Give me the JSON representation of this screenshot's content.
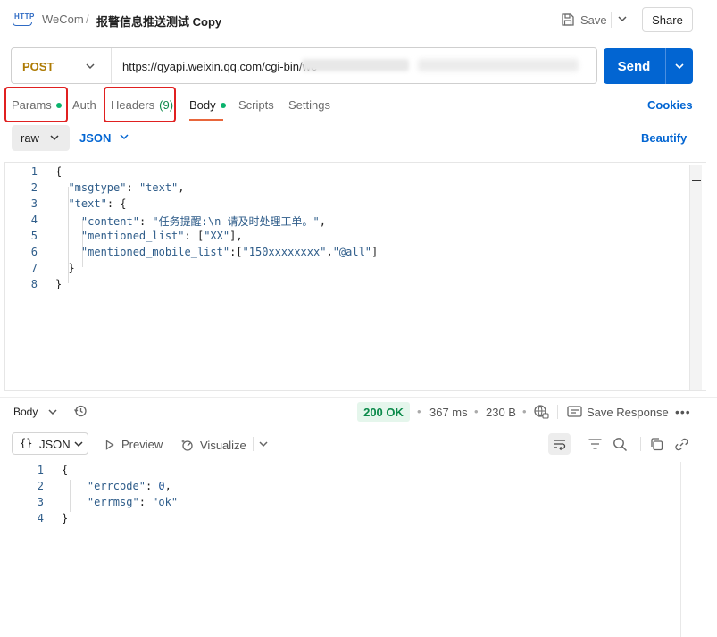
{
  "header": {
    "app_icon": "http-icon",
    "app_icon_text": "HTTP",
    "breadcrumb_parent": "WeCom",
    "breadcrumb_sep": "/",
    "title": "报警信息推送测试 Copy",
    "save_label": "Save",
    "share_label": "Share"
  },
  "request": {
    "method": "POST",
    "url": "https://qyapi.weixin.qq.com/cgi-bin/we",
    "send_label": "Send"
  },
  "tabs": {
    "params": "Params",
    "auth": "Auth",
    "headers": "Headers",
    "headers_count": "(9)",
    "body": "Body",
    "scripts": "Scripts",
    "settings": "Settings",
    "cookies": "Cookies"
  },
  "body_options": {
    "mode": "raw",
    "language": "JSON",
    "beautify": "Beautify"
  },
  "request_body": {
    "line_numbers": [
      "1",
      "2",
      "3",
      "4",
      "5",
      "6",
      "7",
      "8"
    ],
    "lines": [
      "{",
      "  \"msgtype\": \"text\",",
      "  \"text\": {",
      "    \"content\": \"任务提醒:\\n 请及时处理工单。\",",
      "    \"mentioned_list\": [\"XX\"],",
      "    \"mentioned_mobile_list\":[\"150xxxxxxxx\",\"@all\"]",
      "  }",
      "}"
    ]
  },
  "response": {
    "body_label": "Body",
    "status": "200 OK",
    "time": "367 ms",
    "size": "230 B",
    "save_response": "Save Response",
    "more": "•••",
    "format": "JSON",
    "format_brace": "{}",
    "preview": "Preview",
    "visualize": "Visualize",
    "line_numbers": [
      "1",
      "2",
      "3",
      "4"
    ],
    "lines": [
      "{",
      "    \"errcode\": 0,",
      "    \"errmsg\": \"ok\"",
      "}"
    ]
  },
  "colors": {
    "accent": "#0265d2",
    "method": "#ad7a03",
    "status_ok": "#0b8a4a",
    "highlight_box": "#e02020",
    "tab_underline": "#e8663b"
  }
}
